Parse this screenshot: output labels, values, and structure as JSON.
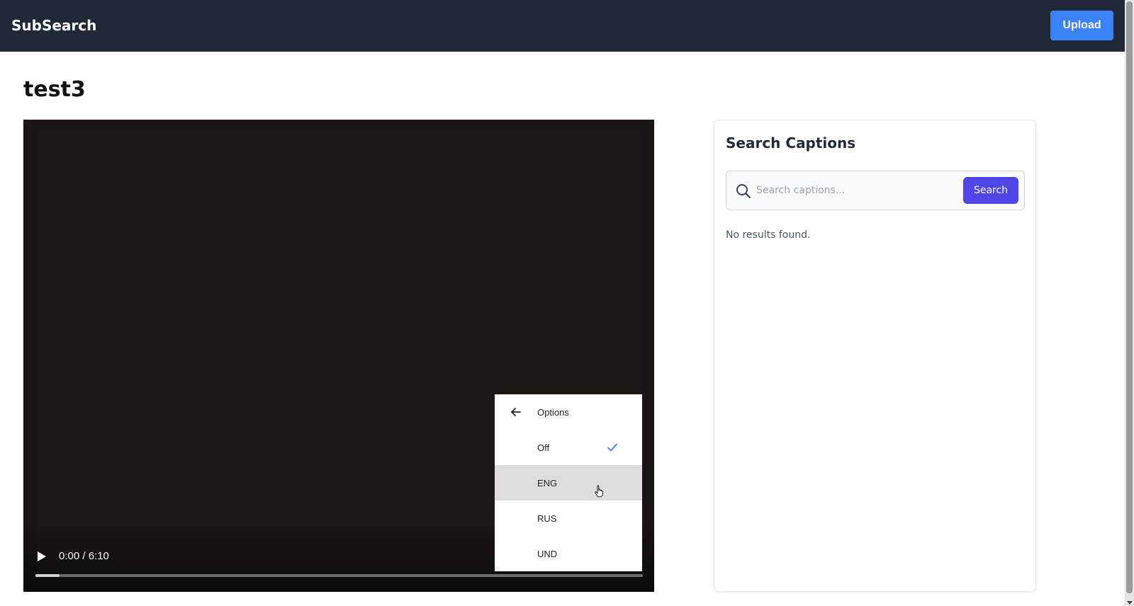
{
  "header": {
    "brand": "SubSearch",
    "upload_label": "Upload",
    "background_color": "#1f2937",
    "accent_color": "#3b82f6"
  },
  "page": {
    "title": "test3"
  },
  "video": {
    "time_display": "0:00 / 6:10",
    "progress": 0.04,
    "captions_menu": {
      "header_label": "Options",
      "items": [
        {
          "label": "Off",
          "selected": true,
          "hovered": false
        },
        {
          "label": "ENG",
          "selected": false,
          "hovered": true
        },
        {
          "label": "RUS",
          "selected": false,
          "hovered": false
        },
        {
          "label": "UND",
          "selected": false,
          "hovered": false
        }
      ]
    }
  },
  "search_panel": {
    "title": "Search Captions",
    "input_value": "",
    "placeholder": "Search captions...",
    "search_label": "Search",
    "button_color": "#4f46e5",
    "status_text": "No results found."
  },
  "icons": {
    "search": "search-icon",
    "back": "arrow-left-icon",
    "check": "checkmark-icon",
    "play": "play-icon"
  }
}
